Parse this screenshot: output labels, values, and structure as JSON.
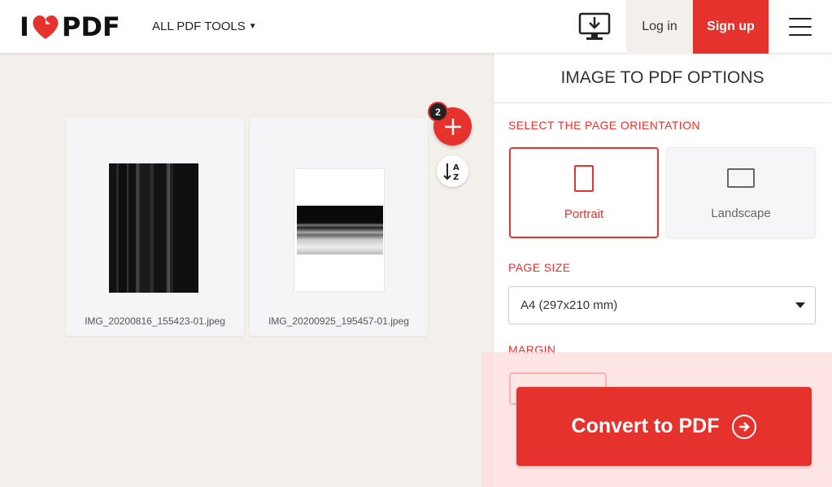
{
  "header": {
    "logo_left": "I",
    "logo_right": "PDF",
    "all_tools": "ALL PDF TOOLS",
    "login": "Log in",
    "signup": "Sign up"
  },
  "workspace": {
    "file_count": "2",
    "files": [
      {
        "name": "IMG_20200816_155423-01.jpeg"
      },
      {
        "name": "IMG_20200925_195457-01.jpeg"
      }
    ]
  },
  "sidebar": {
    "title": "IMAGE TO PDF OPTIONS",
    "orientation_label": "SELECT THE PAGE ORIENTATION",
    "portrait_label": "Portrait",
    "landscape_label": "Landscape",
    "page_size_label": "PAGE SIZE",
    "page_size_value": "A4 (297x210 mm)",
    "margin_label": "MARGIN",
    "convert_label": "Convert to PDF"
  },
  "colors": {
    "brand": "#e5322d",
    "background": "#f3f0ec"
  }
}
